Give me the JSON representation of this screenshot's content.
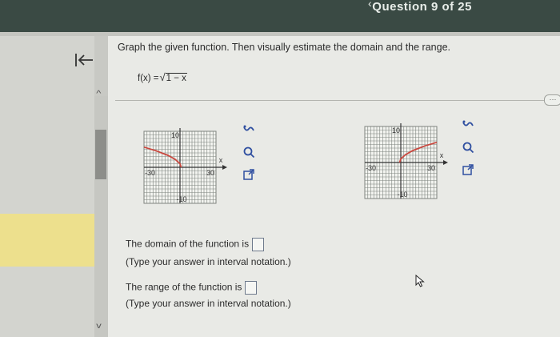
{
  "window": {
    "title": "Question 9 of 25"
  },
  "back_icon": "back-to-start-icon",
  "question": {
    "prompt": "Graph the given function. Then visually estimate the domain and the range.",
    "function_prefix": "f(x) =",
    "function_radicand": "1 − x",
    "function_label": "f(x) = √(1 − x)"
  },
  "graphs": [
    {
      "id": "graph-a",
      "x_range": [
        -30,
        30
      ],
      "y_range": [
        -10,
        10
      ],
      "tick_labels": {
        "x_left": "-30",
        "x_right": "30",
        "y_top": "10",
        "y_bottom": "-10",
        "x_axis": "x"
      },
      "curve": "decreasing left branch",
      "sample_points": [
        [
          -30,
          5.6
        ],
        [
          -20,
          4.6
        ],
        [
          -10,
          3.3
        ],
        [
          -4,
          2.2
        ],
        [
          0,
          1.0
        ],
        [
          1,
          0
        ]
      ]
    },
    {
      "id": "graph-b",
      "x_range": [
        -30,
        30
      ],
      "y_range": [
        -10,
        10
      ],
      "tick_labels": {
        "x_left": "-30",
        "x_right": "30",
        "y_top": "10",
        "y_bottom": "-10",
        "x_axis": "x"
      },
      "curve": "increasing right branch",
      "sample_points": [
        [
          -1,
          0
        ],
        [
          0,
          1.0
        ],
        [
          4,
          2.2
        ],
        [
          10,
          3.3
        ],
        [
          20,
          4.6
        ],
        [
          30,
          5.6
        ]
      ]
    }
  ],
  "tools": [
    "link-icon",
    "zoom-icon",
    "external-link-icon"
  ],
  "answers": {
    "domain_label": "The domain of the function is",
    "domain_hint": "(Type your answer in interval notation.)",
    "range_label": "The range of the function is",
    "range_hint": "(Type your answer in interval notation.)",
    "domain_value": "",
    "range_value": ""
  },
  "colors": {
    "curve": "#c9473e",
    "grid": "#7e837e",
    "axis": "#333333",
    "accent_box": "#6e7a8c"
  }
}
